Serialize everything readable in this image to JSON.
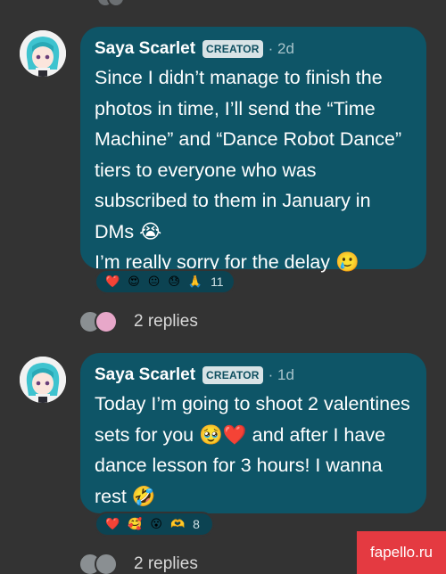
{
  "posts": [
    {
      "author": "Saya Scarlet",
      "badge": "CREATOR",
      "time": "· 2d",
      "body": "Since I didn’t manage to finish the photos in time, I’ll send the “Time Machine” and “Dance Robot Dance” tiers to everyone who was subscribed to them in January in DMs 😭",
      "body2": "I’m really sorry for the delay 🥲",
      "reactions": [
        "❤️",
        "😍",
        "😐",
        "😓",
        "🙏"
      ],
      "reaction_count": "11",
      "replies": "2 replies"
    },
    {
      "author": "Saya Scarlet",
      "badge": "CREATOR",
      "time": "· 1d",
      "body": "Today I’m going to shoot 2 valentines sets for you 🥹❤️  and after I have dance lesson for 3 hours! I wanna rest 🤣",
      "reactions": [
        "❤️",
        "🥰",
        "😮",
        "🫶"
      ],
      "reaction_count": "8",
      "replies": "2 replies"
    }
  ],
  "watermark": "fapello.ru"
}
